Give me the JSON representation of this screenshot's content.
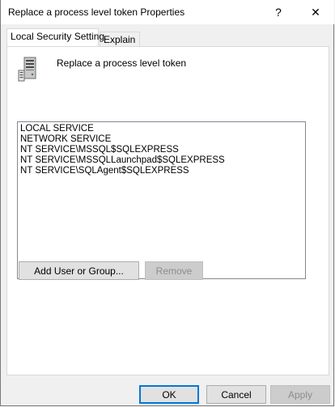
{
  "window": {
    "title": "Replace a process level token Properties",
    "help_glyph": "?",
    "close_glyph": "✕"
  },
  "tabs": [
    {
      "label": "Local Security Setting",
      "active": true
    },
    {
      "label": "Explain",
      "active": false
    }
  ],
  "policy": {
    "icon": "server-icon",
    "name": "Replace a process level token"
  },
  "accounts": [
    "LOCAL SERVICE",
    "NETWORK SERVICE",
    "NT SERVICE\\MSSQL$SQLEXPRESS",
    "NT SERVICE\\MSSQLLaunchpad$SQLEXPRESS",
    "NT SERVICE\\SQLAgent$SQLEXPRESS"
  ],
  "actions": {
    "add_label": "Add User or Group...",
    "remove_label": "Remove"
  },
  "footer": {
    "ok_label": "OK",
    "cancel_label": "Cancel",
    "apply_label": "Apply"
  },
  "colors": {
    "accent": "#0078d7",
    "disabled_text": "#8d8d8d"
  }
}
